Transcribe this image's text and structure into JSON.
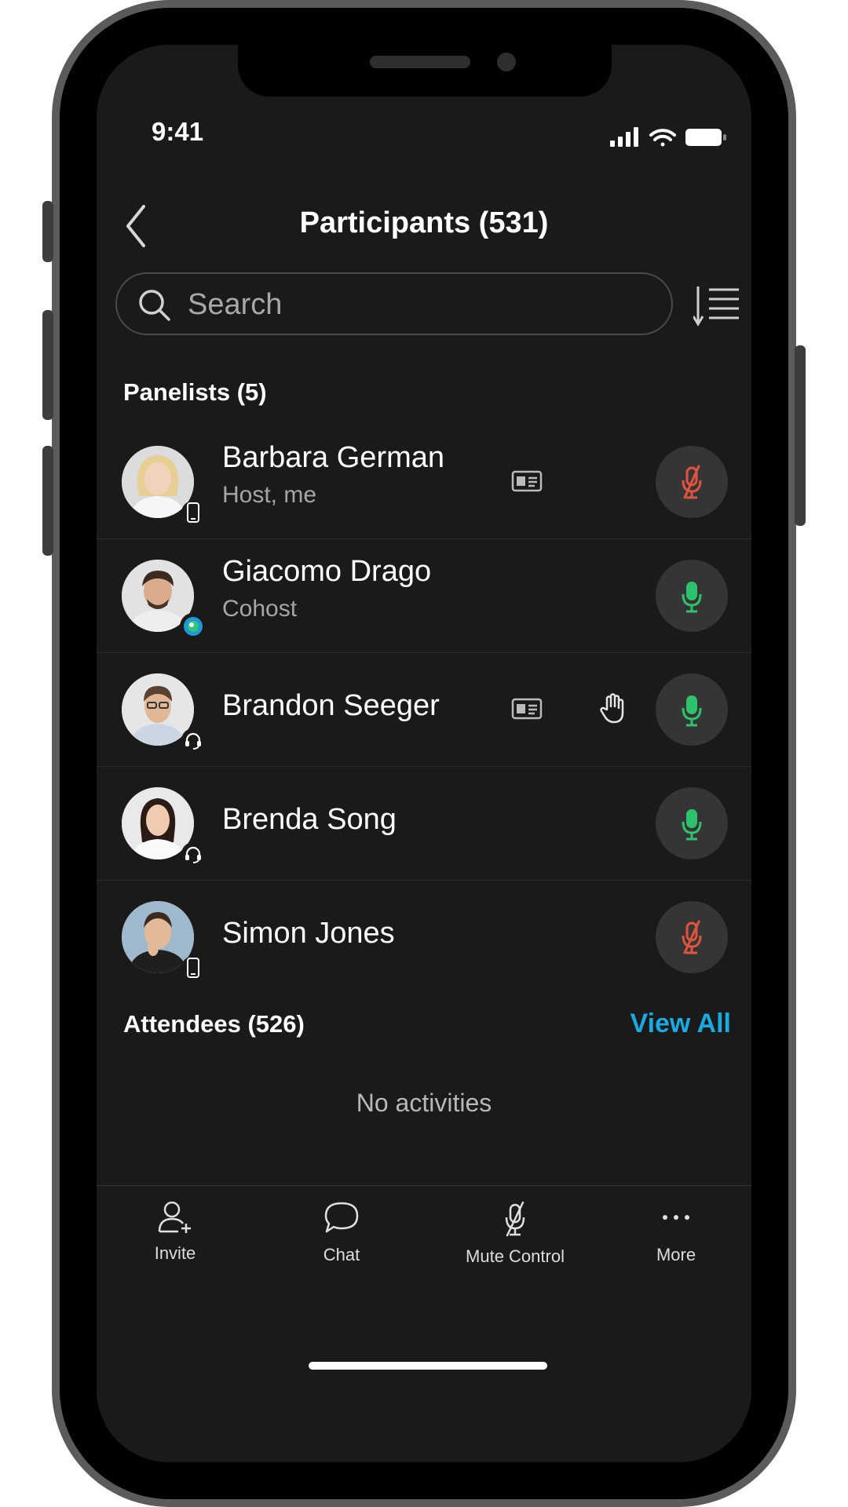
{
  "status_bar": {
    "time": "9:41"
  },
  "header": {
    "title": "Participants (531)"
  },
  "search": {
    "placeholder": "Search"
  },
  "panelists": {
    "label": "Panelists (5)",
    "items": [
      {
        "name": "Barbara German",
        "role": "Host, me",
        "device": "mobile",
        "mic": "muted",
        "has_card": true,
        "hand_raised": false
      },
      {
        "name": "Giacomo Drago",
        "role": "Cohost",
        "device": "webex-app",
        "mic": "unmuted",
        "has_card": false,
        "hand_raised": false
      },
      {
        "name": "Brandon Seeger",
        "role": "",
        "device": "headset",
        "mic": "unmuted",
        "has_card": true,
        "hand_raised": true
      },
      {
        "name": "Brenda Song",
        "role": "",
        "device": "headset",
        "mic": "unmuted",
        "has_card": false,
        "hand_raised": false
      },
      {
        "name": "Simon Jones",
        "role": "",
        "device": "mobile",
        "mic": "muted",
        "has_card": false,
        "hand_raised": false
      }
    ]
  },
  "attendees": {
    "label": "Attendees (526)",
    "view_all": "View All",
    "empty": "No activities"
  },
  "toolbar": {
    "invite": "Invite",
    "chat": "Chat",
    "mute_control": "Mute Control",
    "more": "More"
  },
  "colors": {
    "accent": "#1ba9e0",
    "muted": "#e0533d",
    "unmuted": "#2dc26b",
    "background": "#1a1a1a"
  }
}
